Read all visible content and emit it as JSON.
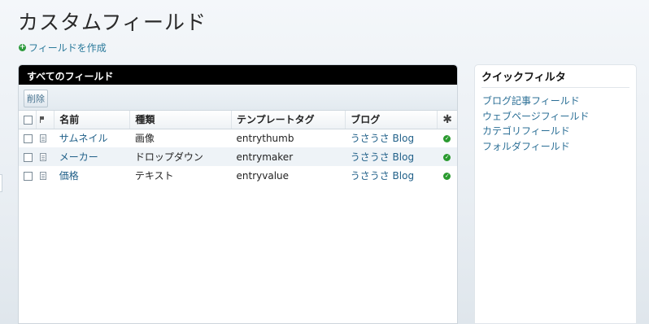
{
  "page": {
    "title": "カスタムフィールド",
    "create_link": "フィールドを作成"
  },
  "panel": {
    "header": "すべてのフィールド",
    "delete_button": "削除",
    "columns": {
      "name": "名前",
      "type": "種類",
      "tag": "テンプレートタグ",
      "blog": "ブログ",
      "status_icon": "star-icon"
    },
    "rows": [
      {
        "name": "サムネイル",
        "type": "画像",
        "tag": "entrythumb",
        "blog": "うさうさ Blog",
        "status": "enabled"
      },
      {
        "name": "メーカー",
        "type": "ドロップダウン",
        "tag": "entrymaker",
        "blog": "うさうさ Blog",
        "status": "enabled"
      },
      {
        "name": "価格",
        "type": "テキスト",
        "tag": "entryvalue",
        "blog": "うさうさ Blog",
        "status": "enabled"
      }
    ]
  },
  "quick_filter": {
    "title": "クイックフィルタ",
    "items": [
      "ブログ記事フィールド",
      "ウェブページフィールド",
      "カテゴリフィールド",
      "フォルダフィールド"
    ]
  },
  "colors": {
    "link": "#1f5f88",
    "header_bg": "#000000",
    "status_ok": "#2a9a2f",
    "add_icon": "#2d9a3c"
  }
}
